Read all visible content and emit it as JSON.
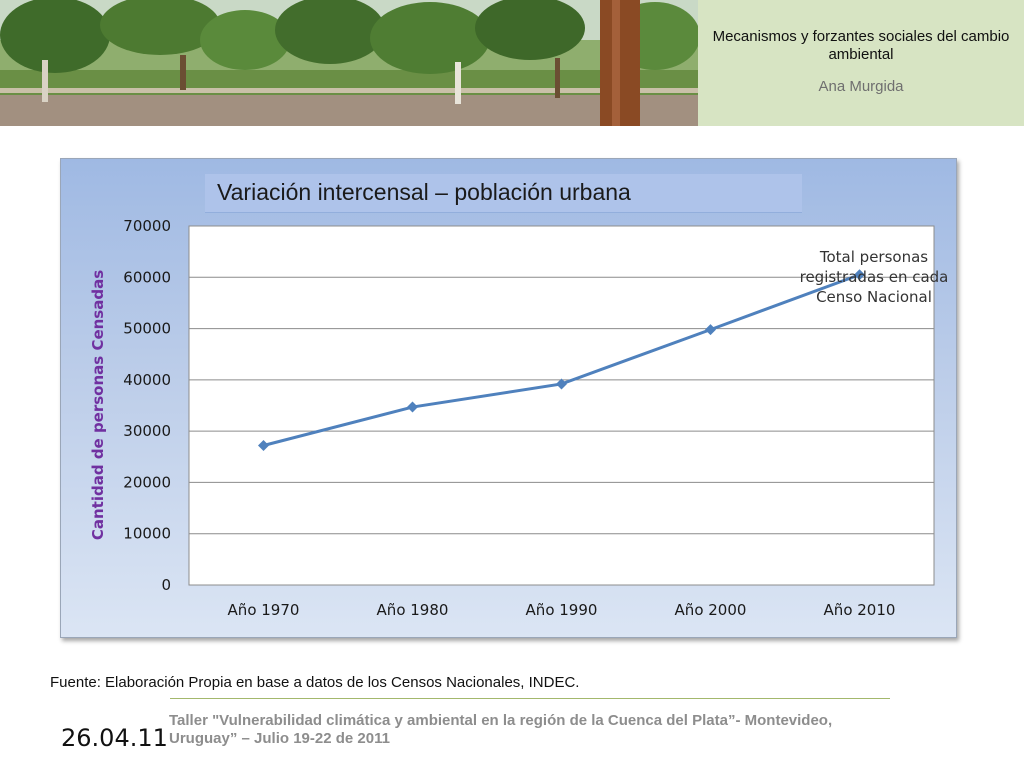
{
  "header": {
    "title": "Mecanismos y forzantes sociales del cambio ambiental",
    "author": "Ana Murgida"
  },
  "colors": {
    "series_line": "#4f81bd",
    "ylabel": "#7030a0",
    "header_panel": "#d7e4c3"
  },
  "chart_data": {
    "type": "line",
    "title": "Variación intercensal – población urbana",
    "ylabel": "Cantidad de personas Censadas",
    "xlabel": "",
    "categories": [
      "Año 1970",
      "Año 1980",
      "Año 1990",
      "Año 2000",
      "Año 2010"
    ],
    "series": [
      {
        "name": "Total personas registradas en cada Censo Nacional",
        "values": [
          27200,
          34700,
          39200,
          49800,
          60500
        ]
      }
    ],
    "ylim": [
      0,
      70000
    ],
    "yticks": [
      "0",
      "10000",
      "20000",
      "30000",
      "40000",
      "50000",
      "60000",
      "70000"
    ],
    "grid": true,
    "legend_lines": [
      "Total personas",
      "registradas en cada",
      "Censo Nacional"
    ]
  },
  "footer": {
    "source": "Fuente: Elaboración Propia en base a datos de los Censos Nacionales, INDEC.",
    "date": "26.04.11",
    "event": "Taller \"Vulnerabilidad climática y ambiental en la región de la Cuenca del Plata”- Montevideo, Uruguay” – Julio 19-22 de 2011"
  }
}
